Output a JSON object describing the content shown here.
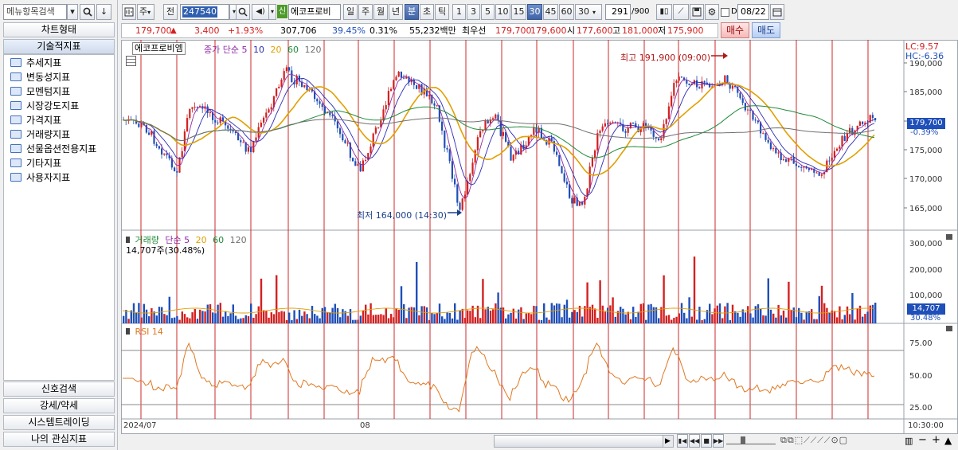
{
  "sidebar": {
    "search_placeholder": "메뉴항목검색",
    "tab_chart_type": "차트형태",
    "tab_technical": "기술적지표",
    "items": [
      "추세지표",
      "변동성지표",
      "모멘텀지표",
      "시장강도지표",
      "가격지표",
      "거래량지표",
      "선물옵션전용지표",
      "기타지표",
      "사용자지표"
    ],
    "bottom_buttons": [
      "신호검색",
      "강세/약세",
      "시스템트레이딩",
      "나의 관심지표"
    ]
  },
  "toolbar": {
    "type_select": "주",
    "prev_label": "전",
    "code": "247540",
    "new_badge": "신",
    "stock_name": "에코프로비",
    "period_buttons": [
      "일",
      "주",
      "월",
      "년",
      "분",
      "초",
      "틱"
    ],
    "active_period": "분",
    "interval_buttons": [
      "1",
      "3",
      "5",
      "10",
      "15",
      "30",
      "45",
      "60"
    ],
    "active_interval": "30",
    "interval_select": "30",
    "count_value": "291",
    "count_max": "/900",
    "date_value": "08/22",
    "date_check_label": "D"
  },
  "quote": {
    "price": "179,700",
    "change_arrow": "▲",
    "change": "3,400",
    "change_pct": "+1.93%",
    "volume": "307,706",
    "turnover_rate": "39.45%",
    "ratio": "0.31%",
    "amount": "55,232백만",
    "best_label": "최우선",
    "best_ask": "179,700",
    "best_bid": "179,600",
    "open_label": "시",
    "open": "177,600",
    "high_label": "고",
    "high": "181,000",
    "low_label": "저",
    "low": "175,900",
    "buy_button": "매수",
    "sell_button": "매도"
  },
  "price_panel": {
    "name_tag": "에코프로비엠",
    "ma_label": "종가 단순",
    "ma_periods": [
      "5",
      "10",
      "20",
      "60",
      "120"
    ],
    "lc": "LC:9.57",
    "hc": "HC:-6.36",
    "current_price": "179,700",
    "current_change": "-0.39%",
    "y_ticks": [
      "190,000",
      "185,000",
      "180,000",
      "175,000",
      "170,000",
      "165,000"
    ],
    "high_annotation": "최고 191,900 (09:00)",
    "low_annotation": "최저 164,000 (14:30)"
  },
  "volume_panel": {
    "label": "거래량",
    "ma_label": "단순",
    "ma_periods": [
      "5",
      "20",
      "60",
      "120"
    ],
    "current": "14,707주(30.48%)",
    "y_ticks": [
      "300,000",
      "200,000",
      "100,000"
    ],
    "badge_value": "14,707",
    "badge_pct": "30.48%"
  },
  "rsi_panel": {
    "label": "RSI 14",
    "y_ticks": [
      "75.00",
      "50.00",
      "25.00"
    ]
  },
  "xaxis": {
    "start_label": "2024/07",
    "mid_label": "08",
    "time_label": "10:30:00"
  },
  "colors": {
    "up": "#d42020",
    "down": "#1f4fb8",
    "ma5": "#8e2aa3",
    "ma10": "#2a2ab8",
    "ma20": "#e0a000",
    "ma60": "#1f8a3a",
    "ma120": "#707070",
    "rsi": "#e07820"
  }
}
